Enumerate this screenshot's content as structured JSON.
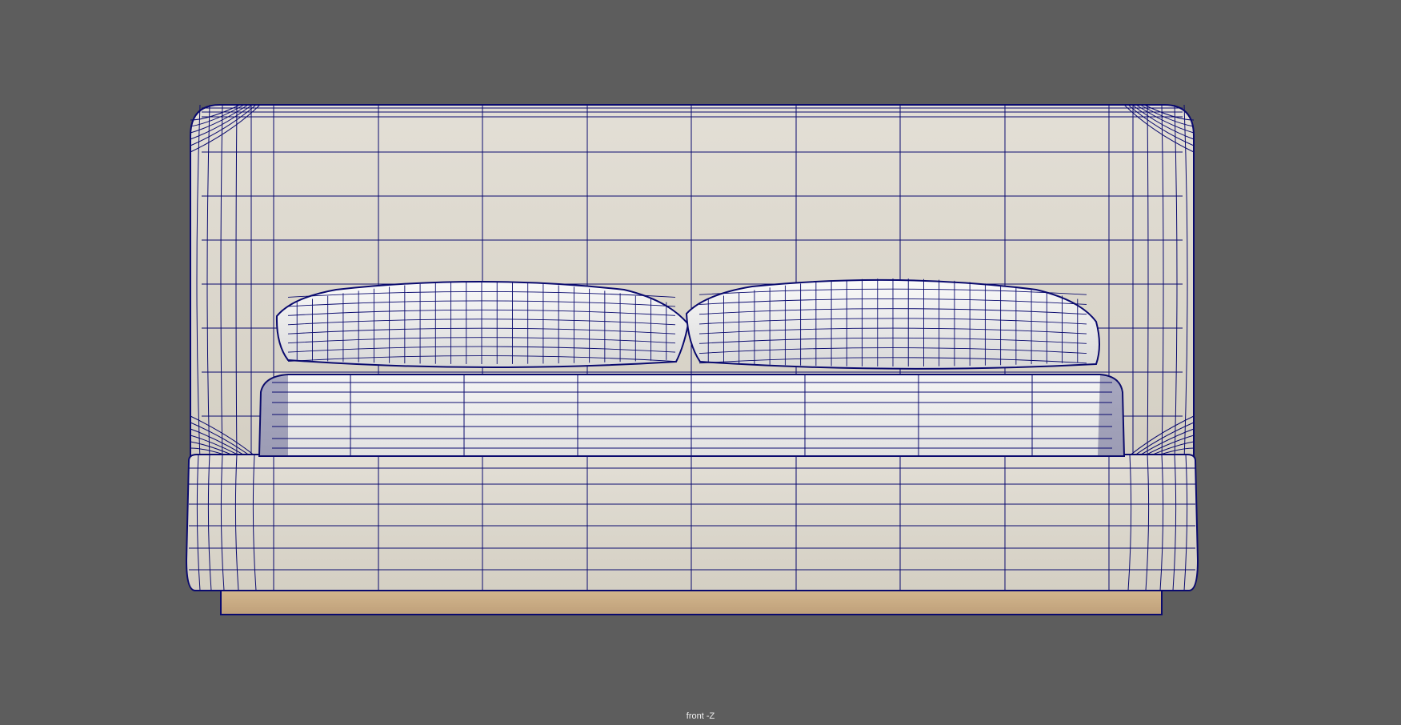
{
  "viewport": {
    "camera_label": "front -Z",
    "background_color": "#5d5d5d",
    "wireframe_color": "#0a0a6e",
    "upholstery_color": "#d9d4c8",
    "bedding_color": "#ececec",
    "base_color": "#c8a97f"
  },
  "model": {
    "parts": [
      "headboard",
      "pillow-left",
      "pillow-right",
      "mattress",
      "bed-frame",
      "wooden-base"
    ]
  }
}
